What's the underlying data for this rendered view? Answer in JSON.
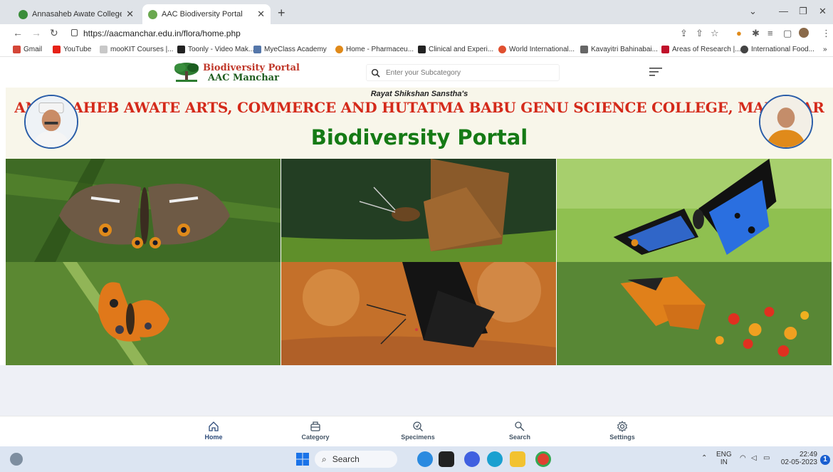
{
  "browser": {
    "tabs": [
      {
        "title": "Annasaheb Awate College | Man",
        "active": false
      },
      {
        "title": "AAC Biodiversity Portal",
        "active": true
      }
    ],
    "url": "https://aacmanchar.edu.in/flora/home.php",
    "bookmarks": [
      "Gmail",
      "YouTube",
      "mooKIT Courses |...",
      "Toonly - Video Mak...",
      "MyeClass Academy",
      "Home - Pharmaceu...",
      "Clinical and Experi...",
      "World International...",
      "Kavayitri Bahinabai...",
      "Areas of Research |...",
      "International Food..."
    ]
  },
  "header": {
    "logo_line1": "Biodiversity Portal",
    "logo_line2": "AAC Manchar",
    "search_placeholder": "Enter your Subcategory"
  },
  "banner": {
    "subtitle": "Rayat Shikshan Sanstha's",
    "college": "ANNASAHEB AWATE ARTS, COMMERCE AND HUTATMA BABU GENU SCIENCE COLLEGE, MANCHAR",
    "portal": "Biodiversity Portal"
  },
  "bottom_nav": [
    {
      "label": "Home",
      "icon": "home-icon",
      "active": true
    },
    {
      "label": "Category",
      "icon": "category-icon",
      "active": false
    },
    {
      "label": "Specimens",
      "icon": "specimens-icon",
      "active": false
    },
    {
      "label": "Search",
      "icon": "search-icon",
      "active": false
    },
    {
      "label": "Settings",
      "icon": "gear-icon",
      "active": false
    }
  ],
  "taskbar": {
    "search_label": "Search",
    "lang_line1": "ENG",
    "lang_line2": "IN",
    "time": "22:49",
    "date": "02-05-2023",
    "notification_count": "1"
  },
  "colors": {
    "college_red": "#d42a1a",
    "portal_green": "#157a15",
    "banner_bg": "#f8f6ea"
  }
}
